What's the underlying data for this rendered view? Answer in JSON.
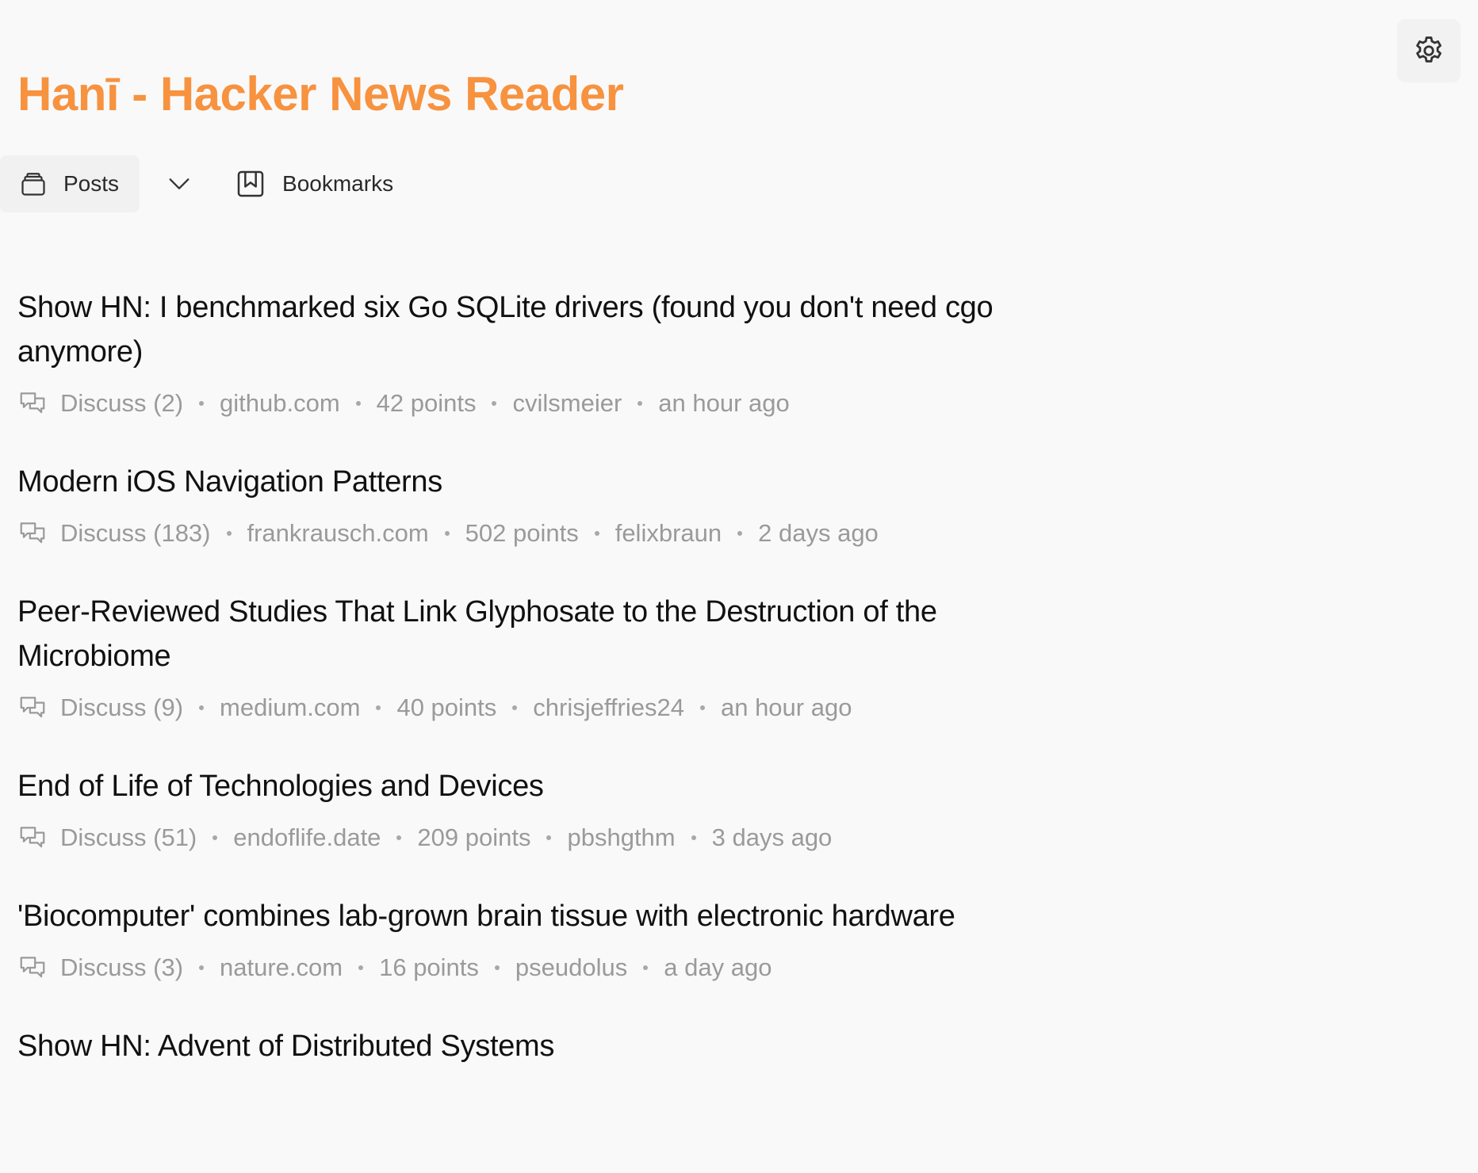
{
  "app": {
    "title": "Hanī - Hacker News Reader"
  },
  "nav": {
    "posts_label": "Posts",
    "bookmarks_label": "Bookmarks"
  },
  "icons": {
    "settings": "gear-icon",
    "posts": "stack-icon",
    "dropdown": "chevron-down-icon",
    "bookmarks": "bookmark-icon",
    "discuss": "chat-bubbles-icon"
  },
  "colors": {
    "accent": "#f7923f",
    "background": "#f9f9f9",
    "meta_text": "#9a9a9a",
    "title_text": "#111111"
  },
  "posts": [
    {
      "title": "Show HN: I benchmarked six Go SQLite drivers (found you don't need cgo anymore)",
      "discuss": "Discuss (2)",
      "domain": "github.com",
      "points": "42 points",
      "author": "cvilsmeier",
      "time": "an hour ago"
    },
    {
      "title": "Modern iOS Navigation Patterns",
      "discuss": "Discuss (183)",
      "domain": "frankrausch.com",
      "points": "502 points",
      "author": "felixbraun",
      "time": "2 days ago"
    },
    {
      "title": "Peer-Reviewed Studies That Link Glyphosate to the Destruction of the Microbiome",
      "discuss": "Discuss (9)",
      "domain": "medium.com",
      "points": "40 points",
      "author": "chrisjeffries24",
      "time": "an hour ago"
    },
    {
      "title": "End of Life of Technologies and Devices",
      "discuss": "Discuss (51)",
      "domain": "endoflife.date",
      "points": "209 points",
      "author": "pbshgthm",
      "time": "3 days ago"
    },
    {
      "title": "'Biocomputer' combines lab-grown brain tissue with electronic hardware",
      "discuss": "Discuss (3)",
      "domain": "nature.com",
      "points": "16 points",
      "author": "pseudolus",
      "time": "a day ago"
    },
    {
      "title": "Show HN: Advent of Distributed Systems"
    }
  ]
}
